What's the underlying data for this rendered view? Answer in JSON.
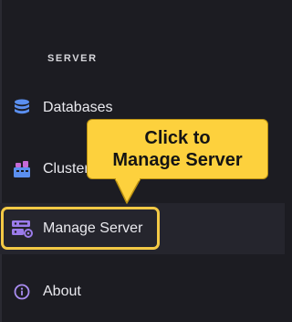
{
  "sidebar": {
    "section_header": "SERVER",
    "items": [
      {
        "label": "Databases",
        "icon": "database-icon"
      },
      {
        "label": "Clusters",
        "icon": "cluster-icon"
      },
      {
        "label": "Manage Server",
        "icon": "server-icon"
      },
      {
        "label": "About",
        "icon": "info-icon"
      }
    ]
  },
  "callout": {
    "line1": "Click to",
    "line2": "Manage Server"
  },
  "colors": {
    "background": "#1c1c22",
    "active_background": "#25252d",
    "highlight": "#f3c945",
    "callout_fill": "#fdd13d",
    "database_icon": "#5b8ff0",
    "server_icon": "#9b7bea",
    "info_icon": "#a98cf0"
  }
}
